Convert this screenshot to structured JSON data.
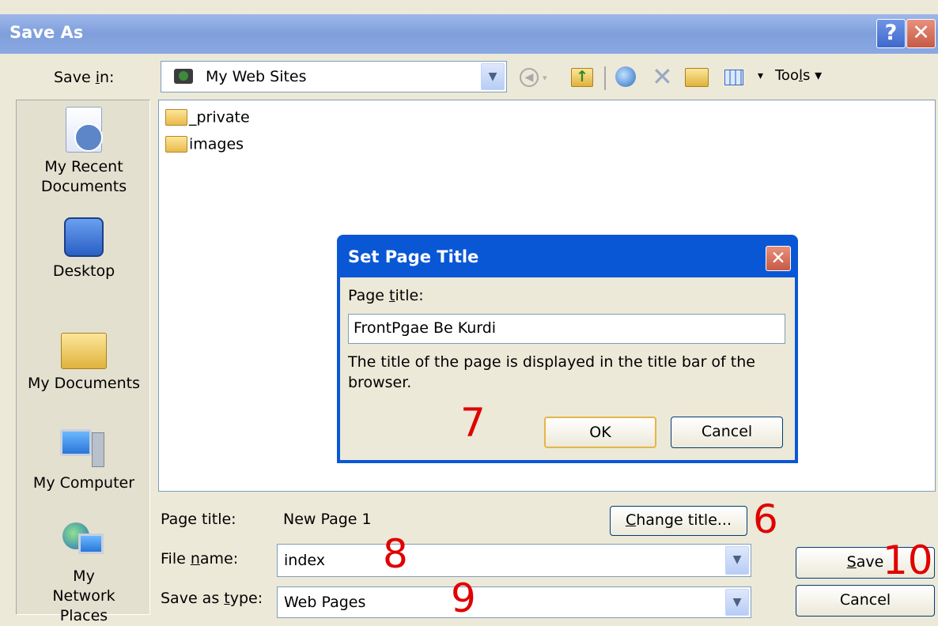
{
  "window": {
    "title": "Save As",
    "help_icon": "?",
    "close_icon": "✕"
  },
  "save_in": {
    "label_pre": "Save ",
    "label_key": "i",
    "label_post": "n:",
    "value": "My Web Sites"
  },
  "toolbar": {
    "tools_pre": "Too",
    "tools_key": "l",
    "tools_post": "s",
    "dropdown_arrow": "▾"
  },
  "places": {
    "recent": "My Recent Documents",
    "desktop": "Desktop",
    "documents": "My Documents",
    "computer": "My Computer",
    "network": "My Network Places"
  },
  "files": {
    "items": [
      "_private",
      "images"
    ]
  },
  "bottom": {
    "page_title_label": "Page title:",
    "page_title_value": "New Page 1",
    "change_title_key": "C",
    "change_title_rest": "hange title...",
    "file_name_pre": "File ",
    "file_name_key": "n",
    "file_name_post": "ame:",
    "file_name_value": "index",
    "save_type_pre": "Save as ",
    "save_type_key": "t",
    "save_type_post": "ype:",
    "save_type_value": "Web Pages",
    "save_key": "S",
    "save_rest": "ave",
    "cancel": "Cancel"
  },
  "dialog": {
    "title": "Set Page Title",
    "close_icon": "✕",
    "label_pre": "Page ",
    "label_key": "t",
    "label_post": "itle:",
    "input_value": "FrontPgae Be Kurdi",
    "description": "The title of the page is displayed in the title bar of the browser.",
    "ok": "OK",
    "cancel": "Cancel"
  },
  "annotations": {
    "n6": "6",
    "n7": "7",
    "n8": "8",
    "n9": "9",
    "n10": "10"
  },
  "colors": {
    "titlebar": "#8aa8e2",
    "dialog_frame": "#0a57d6",
    "annotation": "#e00000"
  }
}
